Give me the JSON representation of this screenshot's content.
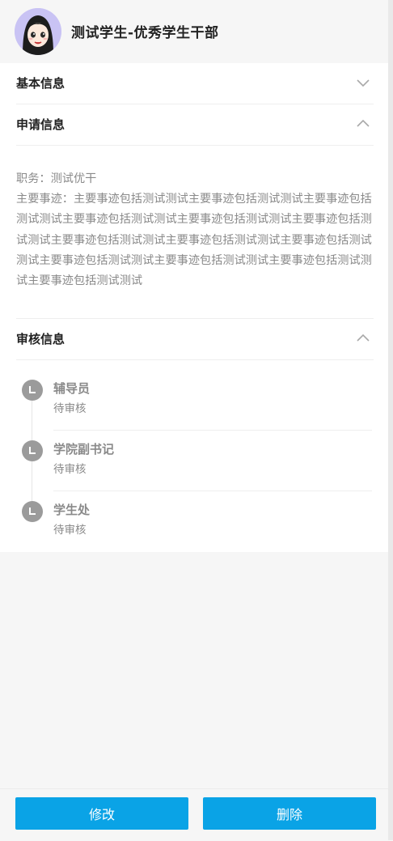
{
  "header": {
    "title": "测试学生-优秀学生干部"
  },
  "sections": {
    "basic_info": {
      "label": "基本信息",
      "state": "collapsed",
      "icon": "chevron-down-icon"
    },
    "application_info": {
      "label": "申请信息",
      "state": "expanded",
      "icon": "chevron-up-icon"
    },
    "review_info": {
      "label": "审核信息",
      "state": "expanded",
      "icon": "chevron-up-icon"
    }
  },
  "application": {
    "duty": "职务：测试优干",
    "deeds": "主要事迹：主要事迹包括测试测试主要事迹包括测试测试主要事迹包括测试测试主要事迹包括测试测试主要事迹包括测试测试主要事迹包括测试测试主要事迹包括测试测试主要事迹包括测试测试主要事迹包括测试测试主要事迹包括测试测试主要事迹包括测试测试主要事迹包括测试测试主要事迹包括测试测试"
  },
  "review": {
    "steps": [
      {
        "name": "辅导员",
        "status": "待审核",
        "icon": "clock-icon"
      },
      {
        "name": "学院副书记",
        "status": "待审核",
        "icon": "clock-icon"
      },
      {
        "name": "学生处",
        "status": "待审核",
        "icon": "clock-icon"
      }
    ]
  },
  "footer": {
    "edit_label": "修改",
    "delete_label": "删除"
  },
  "colors": {
    "primary_button": "#0aa3e6",
    "avatar_ring": "#c9c3f4",
    "timeline_dot": "#9b9b9b",
    "muted_text": "#8a8a8a"
  }
}
